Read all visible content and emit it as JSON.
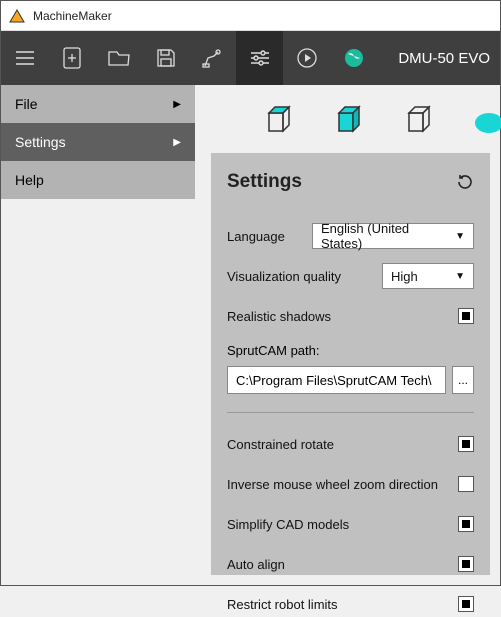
{
  "app": {
    "title": "MachineMaker"
  },
  "toolbar": {
    "project_title": "DMU-50 EVO"
  },
  "menu": {
    "items": [
      {
        "label": "File",
        "has_arrow": true,
        "active": false
      },
      {
        "label": "Settings",
        "has_arrow": true,
        "active": true
      },
      {
        "label": "Help",
        "has_arrow": false,
        "active": false
      }
    ]
  },
  "settings": {
    "title": "Settings",
    "language": {
      "label": "Language",
      "value": "English (United States)"
    },
    "quality": {
      "label": "Visualization quality",
      "value": "High"
    },
    "shadows": {
      "label": "Realistic shadows",
      "checked": true
    },
    "path": {
      "label": "SprutCAM path:",
      "value": "C:\\Program Files\\SprutCAM Tech\\",
      "browse": "..."
    },
    "rotate": {
      "label": "Constrained rotate",
      "checked": true
    },
    "inverse_zoom": {
      "label": "Inverse mouse wheel zoom direction",
      "checked": false
    },
    "simplify": {
      "label": "Simplify CAD models",
      "checked": true
    },
    "auto_align": {
      "label": "Auto align",
      "checked": true
    },
    "restrict_robot": {
      "label": "Restrict robot limits",
      "checked": true
    }
  }
}
